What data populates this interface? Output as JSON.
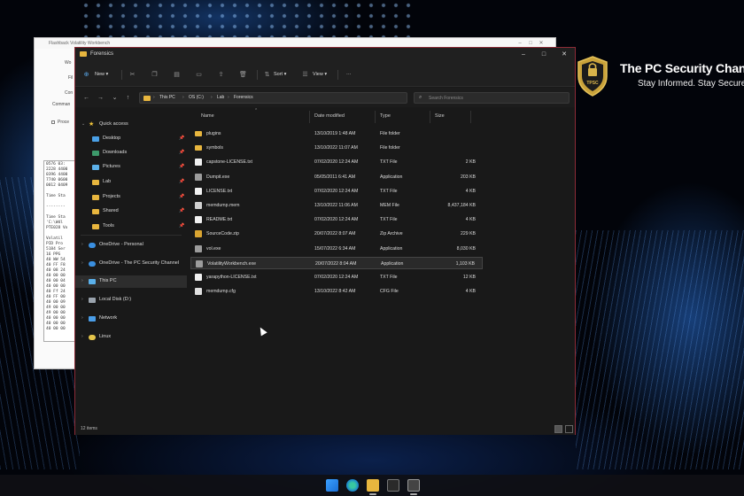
{
  "brand": {
    "title": "The PC Security Chann",
    "subtitle": "Stay Informed. Stay Secure.",
    "shield_text": "TPSC"
  },
  "notepad": {
    "title": "Flashback Volatility Workbench",
    "labels": [
      "Wo",
      "Fil",
      "Con",
      "Comman",
      "Proce"
    ],
    "console_lines": [
      "0576 03:",
      "2228 4400",
      "0396 4400",
      "7740 0600",
      "0012 0409",
      "",
      "Time Sta",
      "",
      "--------",
      "",
      "Time Sta",
      "'C:\\Wdl",
      "PTE028 Vo",
      "",
      "Volatil",
      "PID Pro",
      "5184 Ser",
      "16 PPG",
      "40 WW 54",
      "40 FF F8",
      "40 08 24",
      "40 00 00",
      "40 00 04",
      "40 00 00",
      "40 Ff 24",
      "40 FF 00",
      "40 00 09",
      "49 00 00",
      "49 00 00",
      "40 00 00",
      "40 00 00",
      "40 00 00"
    ]
  },
  "explorer": {
    "title": "Forensics",
    "toolbar": {
      "new_label": "New",
      "sort_label": "Sort",
      "view_label": "View",
      "more_label": "···"
    },
    "breadcrumb": [
      "This PC",
      "OS (C:)",
      "Lab",
      "Forensics"
    ],
    "search": {
      "placeholder": "Search Forensics"
    },
    "sidebar": {
      "quick_access": "Quick access",
      "items": [
        {
          "label": "Desktop",
          "icon": "desktop-icon"
        },
        {
          "label": "Downloads",
          "icon": "downloads-icon"
        },
        {
          "label": "Pictures",
          "icon": "pictures-icon"
        },
        {
          "label": "Lab",
          "icon": "folder-icon"
        },
        {
          "label": "Projects",
          "icon": "folder-icon"
        },
        {
          "label": "Shared",
          "icon": "folder-icon"
        },
        {
          "label": "Tools",
          "icon": "folder-icon"
        }
      ],
      "onedrive_personal": "OneDrive - Personal",
      "onedrive_channel": "OneDrive - The PC Security Channel",
      "this_pc": "This PC",
      "local_disk": "Local Disk (D:)",
      "network": "Network",
      "linux": "Linux"
    },
    "columns": {
      "name": "Name",
      "date": "Date modified",
      "type": "Type",
      "size": "Size"
    },
    "files": [
      {
        "name": "plugins",
        "date": "13/10/2019 1:48 AM",
        "type": "File folder",
        "size": "",
        "icon": "folder"
      },
      {
        "name": "symbols",
        "date": "13/10/2022 11:07 AM",
        "type": "File folder",
        "size": "",
        "icon": "folder"
      },
      {
        "name": "capstone-LICENSE.txt",
        "date": "07/02/2020 12:24 AM",
        "type": "TXT File",
        "size": "2 KB",
        "icon": "txt"
      },
      {
        "name": "Dumpit.exe",
        "date": "05/05/2011 6:41 AM",
        "type": "Application",
        "size": "203 KB",
        "icon": "app"
      },
      {
        "name": "LICENSE.txt",
        "date": "07/02/2020 12:24 AM",
        "type": "TXT File",
        "size": "4 KB",
        "icon": "txt"
      },
      {
        "name": "memdump.mem",
        "date": "13/10/2022 11:06 AM",
        "type": "MEM File",
        "size": "8,437,184 KB",
        "icon": "mem"
      },
      {
        "name": "README.txt",
        "date": "07/02/2020 12:24 AM",
        "type": "TXT File",
        "size": "4 KB",
        "icon": "txt"
      },
      {
        "name": "SourceCode.zip",
        "date": "20/07/2022 8:07 AM",
        "type": "Zip Archive",
        "size": "229 KB",
        "icon": "zip"
      },
      {
        "name": "vol.exe",
        "date": "15/07/2022 6:34 AM",
        "type": "Application",
        "size": "8,030 KB",
        "icon": "app"
      },
      {
        "name": "VolatilityWorkbench.exe",
        "date": "20/07/2022 8:04 AM",
        "type": "Application",
        "size": "1,103 KB",
        "icon": "app"
      },
      {
        "name": "yarapython-LICENSE.txt",
        "date": "07/02/2020 12:24 AM",
        "type": "TXT File",
        "size": "12 KB",
        "icon": "txt"
      },
      {
        "name": "memdump.cfg",
        "date": "13/10/2022 8:42 AM",
        "type": "CFG File",
        "size": "4 KB",
        "icon": "cfg"
      }
    ],
    "status": "12 items"
  },
  "taskbar": {
    "icons": [
      "windows-start-icon",
      "edge-icon",
      "file-explorer-icon",
      "terminal-icon",
      "volatility-workbench-icon"
    ]
  }
}
